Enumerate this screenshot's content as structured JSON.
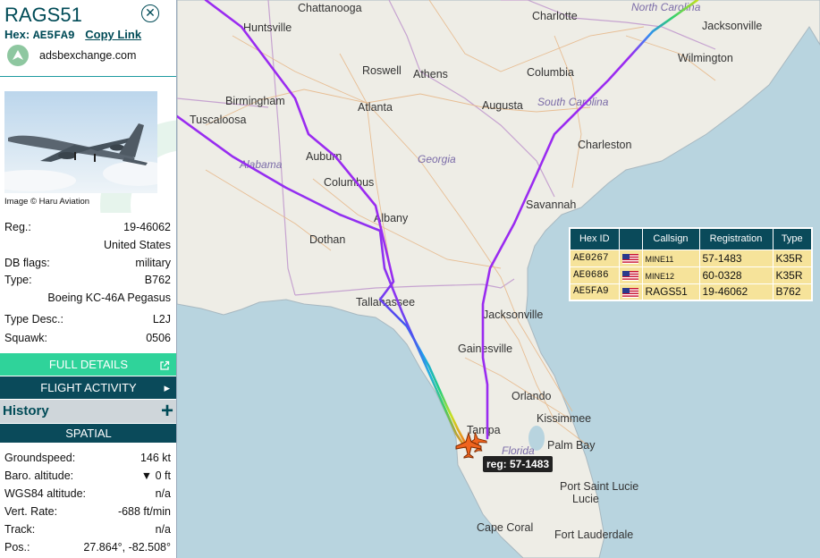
{
  "aircraft": {
    "callsign": "RAGS51",
    "hex_label": "Hex:",
    "hex": "AE5FA9",
    "copy_link": "Copy Link",
    "source": "adsbexchange.com",
    "image_credit": "Image © Haru Aviation"
  },
  "details": {
    "reg_label": "Reg.:",
    "reg": "19-46062",
    "country": "United States",
    "dbflags_label": "DB flags:",
    "dbflags": "military",
    "type_label": "Type:",
    "type": "B762",
    "type_name": "Boeing KC-46A Pegasus",
    "typedesc_label": "Type Desc.:",
    "typedesc": "L2J",
    "squawk_label": "Squawk:",
    "squawk": "0506"
  },
  "buttons": {
    "full_details": "FULL DETAILS",
    "flight_activity": "FLIGHT ACTIVITY",
    "history": "History",
    "spatial": "SPATIAL"
  },
  "spatial": {
    "groundspeed_label": "Groundspeed:",
    "groundspeed": "146 kt",
    "baro_label": "Baro. altitude:",
    "baro": "▼ 0 ft",
    "wgs_label": "WGS84 altitude:",
    "wgs": "n/a",
    "vert_label": "Vert. Rate:",
    "vert": "-688 ft/min",
    "track_label": "Track:",
    "track": "n/a",
    "pos_label": "Pos.:",
    "pos": "27.864°, -82.508°"
  },
  "map": {
    "cities": [
      "Chattanooga",
      "Charlotte",
      "Huntsville",
      "Jacksonville",
      "Wilmington",
      "Roswell",
      "Athens",
      "Columbia",
      "Birmingham",
      "Atlanta",
      "Augusta",
      "Tuscaloosa",
      "Auburn",
      "Charleston",
      "Columbus",
      "Albany",
      "Savannah",
      "Dothan",
      "Tallahassee",
      "Jacksonville",
      "Gainesville",
      "Orlando",
      "Kissimmee",
      "Tampa",
      "Palm Bay",
      "Port Saint Lucie",
      "Cape Coral",
      "Fort Lauderdale"
    ],
    "states": [
      "North Carolina",
      "South Carolina",
      "Alabama",
      "Georgia",
      "Florida"
    ],
    "selected_label": "reg: 57-1483"
  },
  "table": {
    "headers": [
      "Hex ID",
      "",
      "Callsign",
      "Registration",
      "Type"
    ],
    "rows": [
      {
        "hex": "AE0267",
        "callsign": "MINE11",
        "reg": "57-1483",
        "type": "K35R"
      },
      {
        "hex": "AE0686",
        "callsign": "MINE12",
        "reg": "60-0328",
        "type": "K35R"
      },
      {
        "hex": "AE5FA9",
        "callsign": "RAGS51",
        "reg": "19-46062",
        "type": "B762"
      }
    ]
  },
  "colors": {
    "accent": "#004b57",
    "green_bar": "#2fd39a",
    "dark_bar": "#0a4a5a",
    "track_purple": "#9a2bf0",
    "aircraft": "#f0641e",
    "table_row": "#f6e39a"
  }
}
